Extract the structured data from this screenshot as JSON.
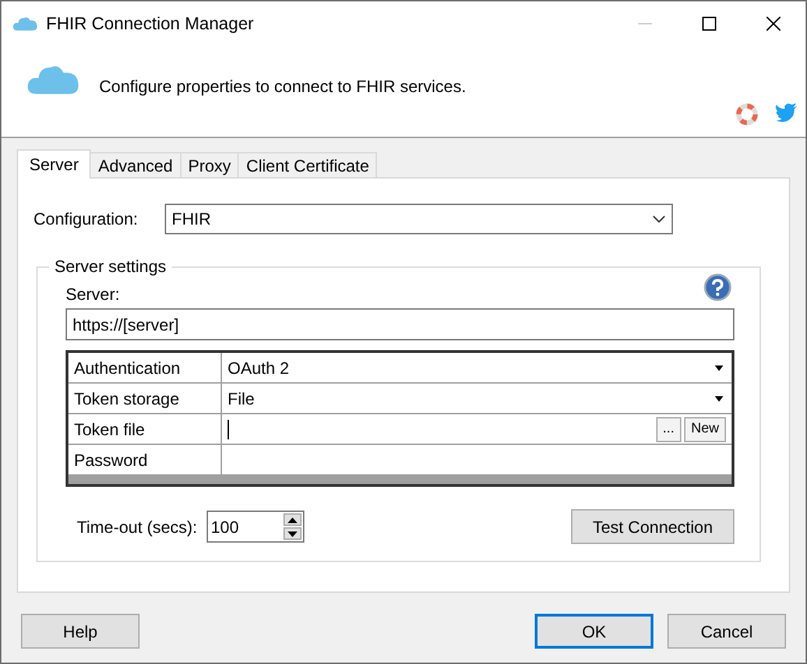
{
  "window": {
    "title": "FHIR Connection Manager"
  },
  "header": {
    "description": "Configure properties to connect to FHIR services."
  },
  "tabs": [
    {
      "label": "Server",
      "selected": true
    },
    {
      "label": "Advanced",
      "selected": false
    },
    {
      "label": "Proxy",
      "selected": false
    },
    {
      "label": "Client Certificate",
      "selected": false
    }
  ],
  "configuration": {
    "label": "Configuration:",
    "value": "FHIR"
  },
  "server_settings": {
    "title": "Server settings",
    "server_label": "Server:",
    "server_value": "https://[server]",
    "properties": [
      {
        "name": "Authentication",
        "value": "OAuth 2",
        "kind": "dropdown"
      },
      {
        "name": "Token storage",
        "value": "File",
        "kind": "dropdown"
      },
      {
        "name": "Token file",
        "kind": "file",
        "browse": "...",
        "new": "New"
      },
      {
        "name": "Password",
        "kind": "text"
      }
    ],
    "timeout_label": "Time-out (secs):",
    "timeout_value": "100",
    "test_button": "Test Connection"
  },
  "buttons": [
    {
      "label": "Help",
      "kind": "help"
    },
    {
      "label": "OK",
      "kind": "default"
    },
    {
      "label": "Cancel",
      "kind": "normal"
    }
  ]
}
